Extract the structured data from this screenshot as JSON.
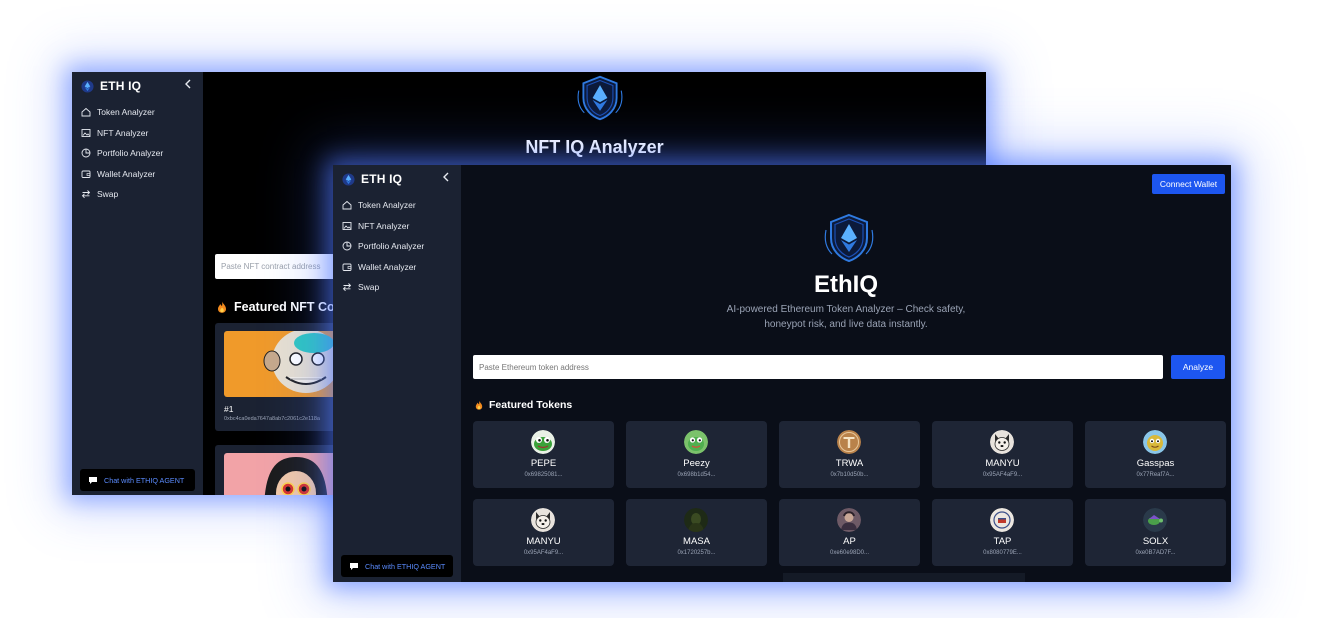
{
  "back_window": {
    "app_name": "ETH IQ",
    "nav": [
      "Token Analyzer",
      "NFT Analyzer",
      "Portfolio Analyzer",
      "Wallet Analyzer",
      "Swap"
    ],
    "chat_label": "Chat with ETHIQ AGENT",
    "hero_title": "NFT IQ Analyzer",
    "input_placeholder": "Paste NFT contract address",
    "featured_title": "Featured NFT Col",
    "nft_cards": [
      {
        "number": "#1",
        "address": "0xbc4ca0eda7647a8ab7c2061c2e118a"
      }
    ]
  },
  "front_window": {
    "app_name": "ETH IQ",
    "nav": [
      "Token Analyzer",
      "NFT Analyzer",
      "Portfolio Analyzer",
      "Wallet Analyzer",
      "Swap"
    ],
    "chat_label": "Chat with ETHIQ AGENT",
    "connect_label": "Connect Wallet",
    "hero_title": "EthIQ",
    "hero_sub_line1": "AI-powered Ethereum Token Analyzer – Check safety,",
    "hero_sub_line2": "honeypot risk, and live data instantly.",
    "input_placeholder": "Paste Ethereum token address",
    "analyze_label": "Analyze",
    "featured_title": "Featured Tokens",
    "tokens": [
      {
        "symbol": "PEPE",
        "address": "0x69825081...",
        "icon": "frog-icon",
        "color": "#3aa23a"
      },
      {
        "symbol": "Peezy",
        "address": "0x698b1d54...",
        "icon": "frog-icon",
        "color": "#4fb04f"
      },
      {
        "symbol": "TRWA",
        "address": "0x7b10d50b...",
        "icon": "t-coin-icon",
        "color": "#b9824a"
      },
      {
        "symbol": "MANYU",
        "address": "0x95AF4aF9...",
        "icon": "shiba-icon",
        "color": "#e8e3dd"
      },
      {
        "symbol": "Gasspas",
        "address": "0x77Reaf7A...",
        "icon": "cartoon-icon",
        "color": "#d9b93a"
      },
      {
        "symbol": "MANYU",
        "address": "0x95AF4aF9...",
        "icon": "shiba-icon",
        "color": "#e8e3dd"
      },
      {
        "symbol": "MASA",
        "address": "0x1720257b...",
        "icon": "dark-avatar-icon",
        "color": "#1e2a16"
      },
      {
        "symbol": "AP",
        "address": "0xe60e98D0...",
        "icon": "photo-avatar-icon",
        "color": "#6e5a66"
      },
      {
        "symbol": "TAP",
        "address": "0x8080779E...",
        "icon": "seal-icon",
        "color": "#ece7e0"
      },
      {
        "symbol": "SOLX",
        "address": "0xe0B7AD7F...",
        "icon": "turtle-icon",
        "color": "#2a3a4a"
      }
    ]
  },
  "colors": {
    "accent": "#1d56f0",
    "chat_text": "#5b8cff",
    "sidebar_bg": "#1b2232",
    "card_bg": "#1e2535"
  }
}
